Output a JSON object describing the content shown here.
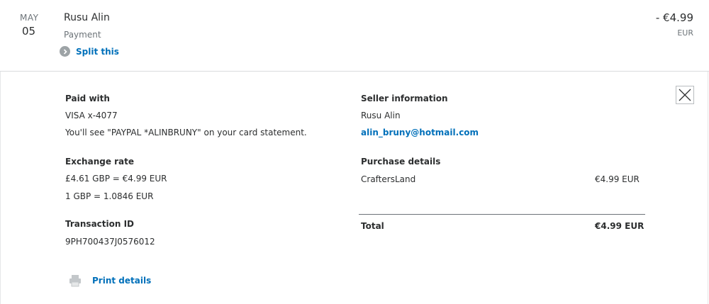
{
  "transaction": {
    "month": "MAY",
    "day": "05",
    "name": "Rusu Alin",
    "type": "Payment",
    "split_label": "Split this",
    "amount": "- €4.99",
    "currency": "EUR"
  },
  "paid_with": {
    "label": "Paid with",
    "card": "VISA x-4077",
    "statement_note": "You'll see \"PAYPAL *ALINBRUNY\" on your card statement."
  },
  "exchange": {
    "label": "Exchange rate",
    "conversion": "£4.61 GBP = €4.99 EUR",
    "rate": "1 GBP = 1.0846 EUR"
  },
  "transaction_id": {
    "label": "Transaction ID",
    "value": "9PH700437J0576012"
  },
  "print": {
    "label": "Print details",
    "icon": "printer-icon"
  },
  "seller": {
    "label": "Seller information",
    "name": "Rusu Alin",
    "email": "alin_bruny@hotmail.com"
  },
  "purchase": {
    "label": "Purchase details",
    "items": [
      {
        "name": "CraftersLand",
        "amount": "€4.99 EUR"
      }
    ],
    "total_label": "Total",
    "total_amount": "€4.99 EUR"
  },
  "colors": {
    "link": "#0070ba",
    "text": "#2c2e2f",
    "muted": "#6c7378"
  }
}
